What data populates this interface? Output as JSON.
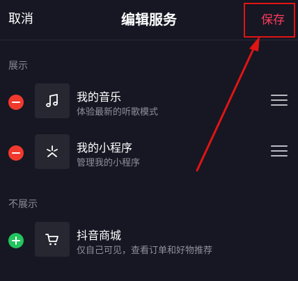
{
  "header": {
    "cancel_label": "取消",
    "title": "编辑服务",
    "save_label": "保存"
  },
  "sections": {
    "shown": {
      "title": "展示",
      "items": [
        {
          "title": "我的音乐",
          "subtitle": "体验最新的听歌模式",
          "icon": "music-note-icon"
        },
        {
          "title": "我的小程序",
          "subtitle": "管理我的小程序",
          "icon": "mini-program-icon"
        }
      ]
    },
    "hidden": {
      "title": "不展示",
      "items": [
        {
          "title": "抖音商城",
          "subtitle": "仅自己可见，查看订单和好物推荐",
          "icon": "shopping-cart-icon"
        }
      ]
    }
  },
  "colors": {
    "background": "#161722",
    "accent": "#ff3b5c",
    "remove": "#f03a2e",
    "add": "#23c45e",
    "annotation": "#e11414"
  }
}
